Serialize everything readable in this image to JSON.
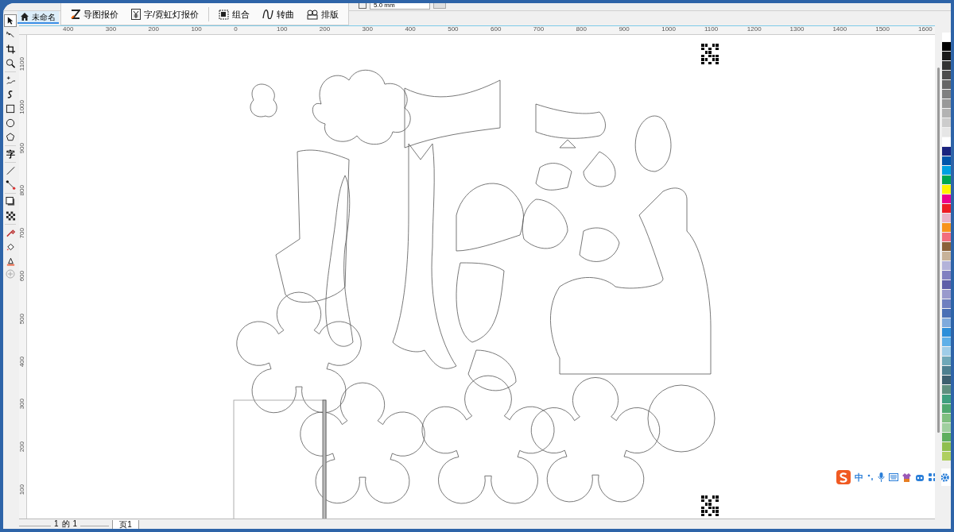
{
  "property_bar": {
    "offset_field": "5.0 mm"
  },
  "popup_toolbar": [
    {
      "kind": "export",
      "label": "导图报价"
    },
    {
      "kind": "yen",
      "label": "字/霓虹灯报价"
    },
    {
      "kind": "group",
      "label": "组合"
    },
    {
      "kind": "curve",
      "label": "转曲"
    },
    {
      "kind": "layout",
      "label": "排版"
    }
  ],
  "document_tab": {
    "label": "未命名",
    "selected": true
  },
  "toolbox": [
    {
      "kind": "pick",
      "selected": true
    },
    {
      "kind": "shape",
      "selected": false
    },
    {
      "kind": "crop",
      "selected": false
    },
    {
      "kind": "zoom",
      "selected": false
    },
    {
      "kind": "freehand",
      "selected": false
    },
    {
      "kind": "artistic",
      "selected": false
    },
    {
      "kind": "rect",
      "selected": false
    },
    {
      "kind": "ellipse",
      "selected": false
    },
    {
      "kind": "polygon",
      "selected": false
    },
    {
      "kind": "text",
      "selected": false,
      "label": "字"
    },
    {
      "kind": "line",
      "selected": false
    },
    {
      "kind": "connector",
      "selected": false
    },
    {
      "kind": "shadow",
      "selected": false
    },
    {
      "kind": "transparency",
      "selected": false
    },
    {
      "kind": "eyedropper",
      "selected": false
    },
    {
      "kind": "fill",
      "selected": false
    },
    {
      "kind": "smartfill",
      "selected": false
    }
  ],
  "ruler_h": [
    "400",
    "300",
    "200",
    "100",
    "0",
    "100",
    "200",
    "300",
    "400",
    "500",
    "600",
    "700",
    "800",
    "900",
    "1000",
    "1100",
    "1200",
    "1300",
    "1400",
    "1500",
    "1600"
  ],
  "ruler_v": [
    "1100",
    "1000",
    "900",
    "800",
    "700",
    "600",
    "500",
    "400",
    "300",
    "200",
    "100"
  ],
  "page_nav": {
    "current": "1",
    "of": "的",
    "total": "1"
  },
  "page_tabs": [
    {
      "label": "页1",
      "selected": true
    }
  ],
  "palette": [
    {
      "color": "#ffffff"
    },
    {
      "color": "#000000"
    },
    {
      "color": "#1a1a1a"
    },
    {
      "color": "#333333"
    },
    {
      "color": "#4d4d4d"
    },
    {
      "color": "#666666"
    },
    {
      "color": "#808080"
    },
    {
      "color": "#999999"
    },
    {
      "color": "#b3b3b3"
    },
    {
      "color": "#cccccc"
    },
    {
      "color": "#e6e6e6"
    },
    {
      "color": "#ffffff"
    },
    {
      "color": "#1a237e"
    },
    {
      "color": "#0055aa"
    },
    {
      "color": "#00a0e0"
    },
    {
      "color": "#00a650"
    },
    {
      "color": "#fff200"
    },
    {
      "color": "#ec008c"
    },
    {
      "color": "#ed1c24"
    },
    {
      "color": "#e8b4c8"
    },
    {
      "color": "#f7941d"
    },
    {
      "color": "#f26d7d"
    },
    {
      "color": "#8c6239"
    },
    {
      "color": "#c7b299"
    },
    {
      "color": "#b3b3d9"
    },
    {
      "color": "#8080c0"
    },
    {
      "color": "#5e5ea8"
    },
    {
      "color": "#9999cc"
    },
    {
      "color": "#6f7fbf"
    },
    {
      "color": "#4a6fb5"
    },
    {
      "color": "#7faadc"
    },
    {
      "color": "#2e8fd9"
    },
    {
      "color": "#5fb0e8"
    },
    {
      "color": "#9fcde8"
    },
    {
      "color": "#6fa8b8"
    },
    {
      "color": "#4d7f8f"
    },
    {
      "color": "#3d5f6f"
    },
    {
      "color": "#5f8f7f"
    },
    {
      "color": "#3f9f7f"
    },
    {
      "color": "#4fa86f"
    },
    {
      "color": "#7fbf7f"
    },
    {
      "color": "#9fcf9f"
    },
    {
      "color": "#5faf5f"
    },
    {
      "color": "#8fbf4f"
    },
    {
      "color": "#afcf5f"
    }
  ],
  "ime_bar": {
    "mode": "中"
  }
}
